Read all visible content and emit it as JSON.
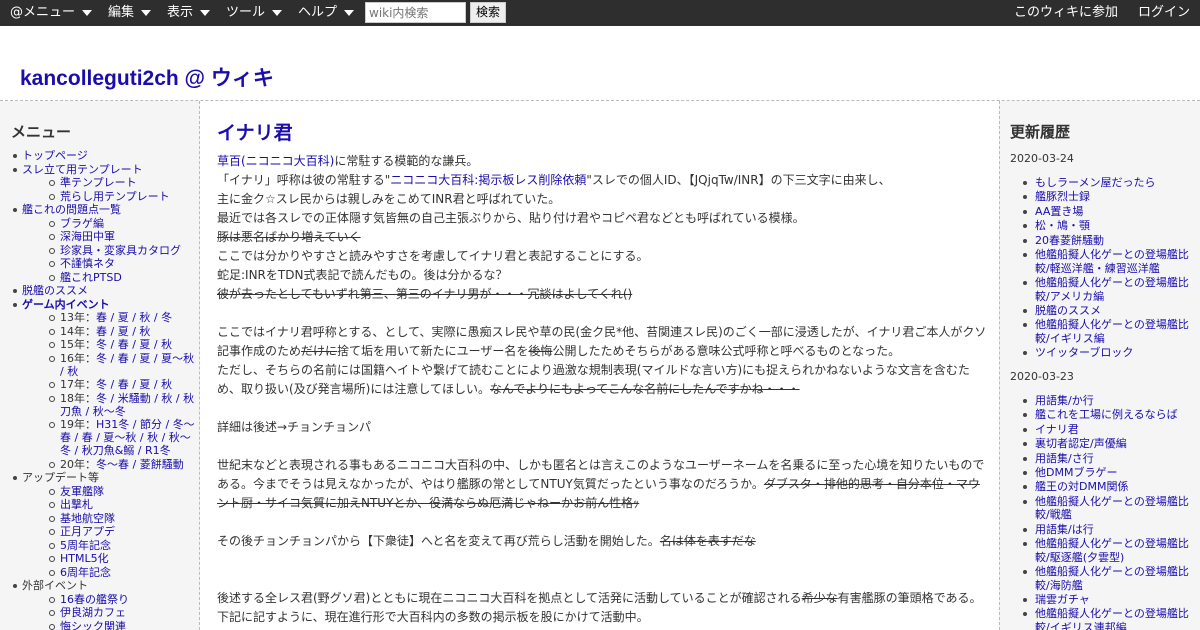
{
  "topbar": {
    "menus": [
      "@メニュー",
      "編集",
      "表示",
      "ツール",
      "ヘルプ"
    ],
    "search_placeholder": "wiki内検索",
    "search_button": "検索",
    "join": "このウィキに参加",
    "login": "ログイン"
  },
  "site": {
    "title": "kancolleguti2ch @ ウィキ"
  },
  "left": {
    "heading": "メニュー",
    "items": [
      {
        "level": 1,
        "text": "トップページ"
      },
      {
        "level": 1,
        "text": "スレ立て用テンプレート"
      },
      {
        "level": 2,
        "text": "準テンプレート"
      },
      {
        "level": 2,
        "text": "荒らし用テンプレート"
      },
      {
        "level": 1,
        "text": "艦これの問題点一覧"
      },
      {
        "level": 2,
        "text": "ブラゲ編"
      },
      {
        "level": 2,
        "text": "深海田中軍"
      },
      {
        "level": 2,
        "text": "珍家具・変家具カタログ"
      },
      {
        "level": 2,
        "text": "不謹慎ネタ"
      },
      {
        "level": 2,
        "text": "艦これPTSD"
      },
      {
        "level": 1,
        "text": "脱艦のススメ"
      },
      {
        "level": 1,
        "text": "ゲーム内イベント",
        "bold": true
      },
      {
        "level": 2,
        "prefix": "13年：",
        "text": "春 / 夏 / 秋 / 冬"
      },
      {
        "level": 2,
        "prefix": "14年：",
        "text": "春 / 夏 / 秋"
      },
      {
        "level": 2,
        "prefix": "15年：",
        "text": "冬 / 春 / 夏 / 秋"
      },
      {
        "level": 2,
        "prefix": "16年：",
        "text": "冬 / 春 / 夏 / 夏～秋 / 秋"
      },
      {
        "level": 2,
        "prefix": "17年：",
        "text": "冬 / 春 / 夏 / 秋"
      },
      {
        "level": 2,
        "prefix": "18年：",
        "text": "冬 / 米騒動 / 秋 / 秋刀魚 / 秋〜冬"
      },
      {
        "level": 2,
        "prefix": "19年：",
        "text": "H31冬 / 節分 / 冬〜春 / 春 / 夏〜秋 / 秋 / 秋～冬 / 秋刀魚&鰯 / R1冬"
      },
      {
        "level": 2,
        "prefix": "20年：",
        "text": "冬〜春 / 菱餅騒動"
      },
      {
        "level": 1,
        "text": "アップデート等",
        "plain": true
      },
      {
        "level": 2,
        "text": "友軍艦隊"
      },
      {
        "level": 2,
        "text": "出撃札"
      },
      {
        "level": 2,
        "text": "基地航空隊"
      },
      {
        "level": 2,
        "text": "正月アプデ"
      },
      {
        "level": 2,
        "text": "5周年記念"
      },
      {
        "level": 2,
        "text": "HTML5化"
      },
      {
        "level": 2,
        "text": "6周年記念"
      },
      {
        "level": 1,
        "text": "外部イベント",
        "plain": true
      },
      {
        "level": 2,
        "text": "16春の艦祭り"
      },
      {
        "level": 2,
        "text": "伊良湖カフェ"
      },
      {
        "level": 2,
        "text": "悔シック関連"
      }
    ]
  },
  "main": {
    "title": "イナリ君",
    "p1_link1": "草百(ニコニコ大百科)",
    "p1_t1": "に常駐する模範的な謙兵。",
    "p2_t1": "「イナリ」呼称は彼の常駐する\"",
    "p2_link": "ニコニコ大百科:掲示板レス削除依頼",
    "p2_t2": "\"スレでの個人ID、【JQjqTw/INR】の下三文字に由来し、",
    "p3": "主に金ク☆スレ民からは親しみをこめてINR君と呼ばれていた。",
    "p4": "最近では各スレでの正体隠す気皆無の自己主張ぶりから、貼り付け君やコピペ君などとも呼ばれている模様。",
    "p5_s": "豚は悪名ばかり増えていく",
    "p6": "ここでは分かりやすさと読みやすさを考慮してイナリ君と表記することにする。",
    "p7": "蛇足:INRをTDN式表記で読んだもの。後は分かるな？",
    "p8_s": "彼が去ったとしてもいずれ第三、第三のイナリ男が・・・冗談はよしてくれ()",
    "p9_t1": "ここではイナリ君呼称とする、として、実際に愚痴スレ民や草の民(金ク民*他、苔関連スレ民)のごく一部に浸透したが、イナリ君ご本人がクソ記事作成のため",
    "p9_s1": "だけに",
    "p9_t2": "捨て垢を用いて新たにユーザー名を",
    "p9_s2": "後悔",
    "p9_t3": "公開したためそちらがある意味公式呼称と呼べるものとなった。",
    "p10_t1": "ただし、そちらの名前には国籍ヘイトや繋げて読むことにより過激な規制表現(マイルドな言い方)にも捉えられかねないような文言を含むため、取り扱い(及び発言場所)には注意してほしい。",
    "p10_s": "なんでよりにもよってこんな名前にしたんですかね・・・",
    "p11": "詳細は後述→チョンチョンパ",
    "p12_t1": "世紀末などと表現される事もあるニコニコ大百科の中、しかも匿名とは言えこのようなユーザーネームを名乗るに至った心境を知りたいものである。今までそうは見えなかったが、やはり艦豚の常としてNTUY気質だったという事なのだろうか。",
    "p12_s": "ダブスタ・排他的思考・自分本位・マウント厨・サイコ気質に加えNTUYとか、役満ならぬ厄満じゃねーかお前ん性格ｯ",
    "p13_t1": "その後チョンチョンパから【下衆徒】へと名を変えて再び荒らし活動を開始した。",
    "p13_s": "名は体を表すだな",
    "p14_t1": "後述する全レス君(野グソ君)とともに現在ニコニコ大百科を拠点として活発に活動していることが確認される",
    "p14_s": "希少な",
    "p14_t2": "有害艦豚の筆頭格である。",
    "p15": "下記に記すように、現在進行形で大百科内の多数の掲示板を股にかけて活動中。"
  },
  "right": {
    "heading": "更新履歴",
    "groups": [
      {
        "date": "2020-03-24",
        "items": [
          "もしラーメン屋だったら",
          "艦豚烈士録",
          "AA置き場",
          "松・鳩・顎",
          "20春菱餅騒動",
          "他艦船擬人化ゲーとの登場艦比較/軽巡洋艦・練習巡洋艦",
          "他艦船擬人化ゲーとの登場艦比較/アメリカ編",
          "脱艦のススメ",
          "他艦船擬人化ゲーとの登場艦比較/イギリス編",
          "ツイッターブロック"
        ]
      },
      {
        "date": "2020-03-23",
        "items": [
          "用語集/か行",
          "艦これを工場に例えるならば",
          "イナリ君",
          "裏切者認定/声優編",
          "用語集/さ行",
          "他DMMブラゲー",
          "艦王の対DMM関係",
          "他艦船擬人化ゲーとの登場艦比較/戦艦",
          "用語集/は行",
          "他艦船擬人化ゲーとの登場艦比較/駆逐艦(夕雲型)",
          "他艦船擬人化ゲーとの登場艦比較/海防艦",
          "瑞雲ガチャ",
          "他艦船擬人化ゲーとの登場艦比較/イギリス連邦編"
        ]
      }
    ]
  }
}
